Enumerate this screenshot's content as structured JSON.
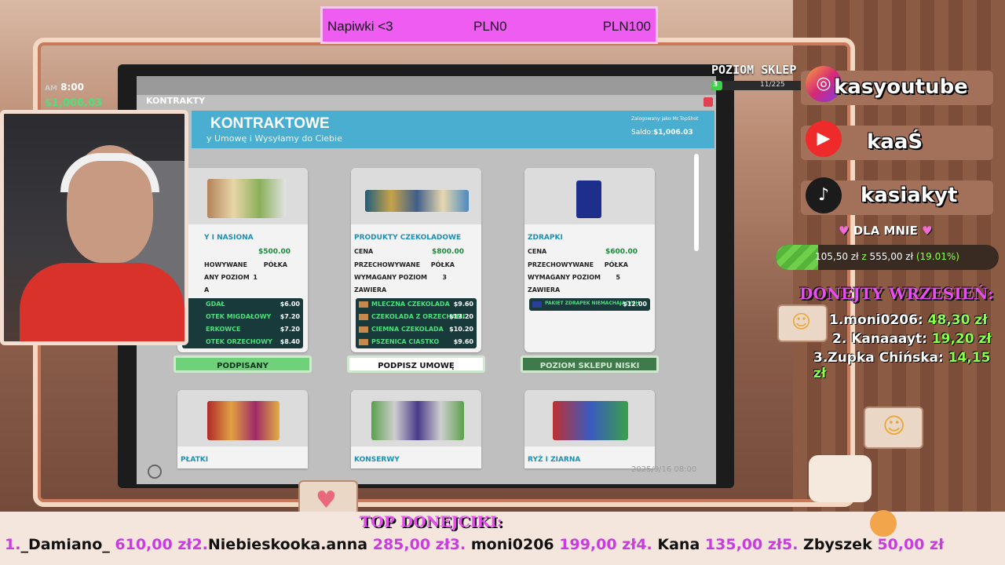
{
  "tip_bar": {
    "label": "Napiwki <3",
    "min": "PLN0",
    "max": "PLN100"
  },
  "hud": {
    "time": "8:00",
    "time_prefix": "AM",
    "money": "1,006.03",
    "shop_level_label": "POZIOM SKLEP",
    "shop_level_value": "3",
    "shop_xp": "11/225",
    "shop_xp_progress": 0.049
  },
  "game_window": {
    "tab": "KONTRAKTY",
    "title": "KONTRAKTOWE",
    "subtitle": "y Umowę i Wysyłamy do Ciebie",
    "login": "Zalogowany jako Mr.TopShot",
    "saldo_label": "Saldo:",
    "saldo": "$1,006.03",
    "timestamp": "2025/9/16 08:00",
    "cards": [
      {
        "name": "Y I NASIONA",
        "price": "$500.00",
        "stored_label": "HOWYWANE",
        "stored_value": "PÓŁKA",
        "level_label": "ANY POZIOM",
        "level_value": "1",
        "contains_label": "A",
        "items": [
          {
            "name": "GDAŁ",
            "price": "$6.00"
          },
          {
            "name": "OTEK MIGDAŁOWY",
            "price": "$7.20"
          },
          {
            "name": "ERKOWCE",
            "price": "$7.20"
          },
          {
            "name": "OTEK ORZECHOWY",
            "price": "$8.40"
          }
        ],
        "button": "PODPISANY"
      },
      {
        "name": "PRODUKTY CZEKOLADOWE",
        "price_label": "CENA",
        "price": "$800.00",
        "stored_label": "PRZECHOWYWANE",
        "stored_value": "PÓŁKA",
        "level_label": "WYMAGANY POZIOM",
        "level_value": "3",
        "contains_label": "ZAWIERA",
        "items": [
          {
            "name": "MLECZNA CZEKOLADA",
            "price": "$9.60"
          },
          {
            "name": "CZEKOLADA Z ORZECHAMI",
            "price": "$13.20"
          },
          {
            "name": "CIEMNA CZEKOLADA",
            "price": "$10.20"
          },
          {
            "name": "PSZENICA CIASTKO",
            "price": "$9.60"
          }
        ],
        "button": "PODPISZ UMOWĘ"
      },
      {
        "name": "ZDRAPKI",
        "price_label": "CENA",
        "price": "$600.00",
        "stored_label": "PRZECHOWYWANE",
        "stored_value": "PÓŁKA",
        "level_label": "WYMAGANY POZIOM",
        "level_value": "5",
        "contains_label": "ZAWIERA",
        "items": [
          {
            "name": "PAKIET ZDRAPEK NIEMACHAJĄCYCH",
            "price": "$12.00"
          }
        ],
        "button": "POZIOM SKLEPU NISKI"
      }
    ],
    "cards_row2": [
      "PŁATKI",
      "KONSERWY",
      "RYŻ I ZIARNA"
    ]
  },
  "socials": [
    {
      "icon": "instagram-icon",
      "name": "kasyoutube"
    },
    {
      "icon": "youtube-icon",
      "name": "kaaŚ"
    },
    {
      "icon": "tiktok-icon",
      "name": "kasiakyt"
    }
  ],
  "goal": {
    "label": "DLA MNIE",
    "current": "105,50 zł",
    "sep": "z",
    "target": "555,00 zł",
    "percent": "(19.01%)",
    "progress": 0.1901
  },
  "donations_month": {
    "title": "DONEJTY WRZESIEŃ:",
    "rows": [
      {
        "rank": "1.",
        "name": "moni0206:",
        "amount": "48,30 zł"
      },
      {
        "rank": "2.",
        "name": "Kanaaayt:",
        "amount": "19,20 zł"
      },
      {
        "rank": "3.",
        "name": "Zupka Chińska:",
        "amount": "14,15 zł"
      }
    ]
  },
  "top_donors": {
    "title": "TOP DONEJCIKI:",
    "rows": [
      {
        "rank": "1.",
        "name": "_Damiano_",
        "amount": "610,00 zł"
      },
      {
        "rank": "2.",
        "name": "Niebieskooka.anna",
        "amount": "285,00 zł"
      },
      {
        "rank": "3.",
        "name": "moni0206",
        "amount": "199,00 zł"
      },
      {
        "rank": "4.",
        "name": "Kana",
        "amount": "135,00 zł"
      },
      {
        "rank": "5.",
        "name": "Zbyszek",
        "amount": "50,00 zł"
      }
    ]
  },
  "colors": {
    "tip_bar": "#ee5cf1",
    "header": "#4aaed0",
    "accent_pink": "#e74ef0",
    "accent_green": "#8cff4a"
  }
}
